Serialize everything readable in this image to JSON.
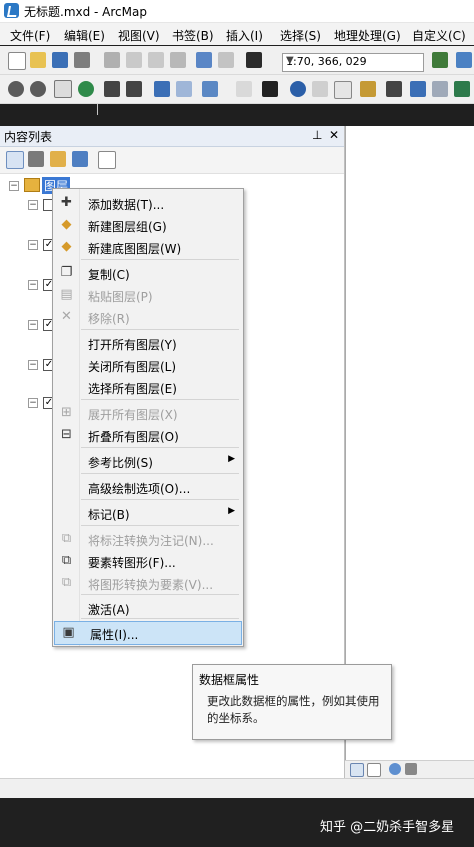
{
  "window": {
    "title": "无标题.mxd - ArcMap"
  },
  "menubar": {
    "items": [
      "文件(F)",
      "编辑(E)",
      "视图(V)",
      "书签(B)",
      "插入(I)",
      "选择(S)",
      "地理处理(G)",
      "自定义(C)"
    ]
  },
  "toolbar": {
    "scale": "1:70, 366, 029"
  },
  "toc": {
    "title": "内容列表",
    "pin": "ᵽ",
    "close": "✕",
    "root_layer": "图层"
  },
  "context_menu": {
    "items": [
      {
        "label": "添加数据(T)...",
        "icon": "add-data-icon",
        "glyph": "✚",
        "disabled": false
      },
      {
        "label": "新建图层组(G)",
        "icon": "new-group-layer-icon",
        "glyph": "◆",
        "disabled": false
      },
      {
        "label": "新建底图图层(W)",
        "icon": "new-basemap-layer-icon",
        "glyph": "◆",
        "disabled": false
      },
      {
        "label": "复制(C)",
        "icon": "copy-icon",
        "glyph": "❐",
        "disabled": false
      },
      {
        "label": "粘贴图层(P)",
        "icon": "paste-icon",
        "glyph": "▤",
        "disabled": true
      },
      {
        "label": "移除(R)",
        "icon": "remove-icon",
        "glyph": "✕",
        "disabled": true
      },
      {
        "label": "打开所有图层(Y)",
        "icon": "",
        "glyph": "",
        "disabled": false
      },
      {
        "label": "关闭所有图层(L)",
        "icon": "",
        "glyph": "",
        "disabled": false
      },
      {
        "label": "选择所有图层(E)",
        "icon": "",
        "glyph": "",
        "disabled": false
      },
      {
        "label": "展开所有图层(X)",
        "icon": "expand-icon",
        "glyph": "⊞",
        "disabled": true
      },
      {
        "label": "折叠所有图层(O)",
        "icon": "collapse-icon",
        "glyph": "⊟",
        "disabled": false
      },
      {
        "label": "参考比例(S)",
        "icon": "",
        "glyph": "",
        "disabled": false,
        "submenu": true
      },
      {
        "label": "高级绘制选项(O)...",
        "icon": "",
        "glyph": "",
        "disabled": false
      },
      {
        "label": "标记(B)",
        "icon": "",
        "glyph": "",
        "disabled": false,
        "submenu": true
      },
      {
        "label": "将标注转换为注记(N)...",
        "icon": "convert-labels-icon",
        "glyph": "⧉",
        "disabled": true
      },
      {
        "label": "要素转图形(F)...",
        "icon": "features-to-graphics-icon",
        "glyph": "⧉",
        "disabled": false
      },
      {
        "label": "将图形转换为要素(V)...",
        "icon": "graphics-to-features-icon",
        "glyph": "⧉",
        "disabled": true
      },
      {
        "label": "激活(A)",
        "icon": "",
        "glyph": "",
        "disabled": false
      },
      {
        "label": "属性(I)...",
        "icon": "properties-icon",
        "glyph": "▣",
        "disabled": false,
        "selected": true
      }
    ]
  },
  "tooltip": {
    "title": "数据框属性",
    "body": "更改此数据框的属性，例如其使用的坐标系。"
  },
  "watermark": "知乎 @二奶杀手智多星",
  "colors": {
    "selection": "#cce4f7",
    "highlight_label": "#3a78d4"
  }
}
